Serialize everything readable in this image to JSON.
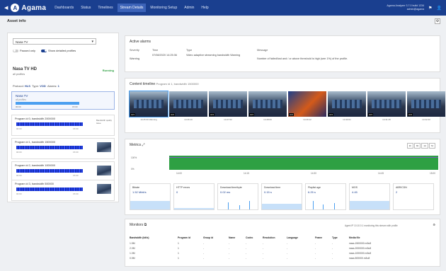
{
  "topbar": {
    "logo": "Agama",
    "nav": [
      "Dashboards",
      "Status",
      "Timelines",
      "Stream Details",
      "Monitoring Setup",
      "Admin",
      "Help"
    ],
    "active_nav": "Stream Details",
    "account_line1": "Agama Analyzer 3.7.0 build 1234",
    "account_line2": "admin@agama"
  },
  "page": {
    "title": "Asset info"
  },
  "left": {
    "select_value": "Nasa TV",
    "toggle_paused": "Paused only",
    "toggle_details": "Show detailed profiles",
    "asset_title": "Nasa TV HD",
    "asset_sub": "all profiles",
    "status": "Running",
    "protocol_label": "Protocol:",
    "protocol_value": "HLS",
    "type_label": "Type:",
    "type_value": "VOD",
    "alarms_label": "Alarms:",
    "alarms_value": "1",
    "summary": {
      "name": "Nasa TV",
      "sub": "all profiles",
      "left": "00:00",
      "right": "15:00"
    },
    "programs": [
      {
        "title": "Program id 0, bandwidth 2000000",
        "left": "00:00",
        "right": "15:00",
        "label": "Bandwidth quality issue"
      },
      {
        "title": "Program id 1, bandwidth 1500000",
        "left": "00:00",
        "right": "15:00"
      },
      {
        "title": "Program id 2, bandwidth 1000000",
        "left": "00:00",
        "right": "15:00"
      },
      {
        "title": "Program id 3, bandwidth 500000",
        "left": "00:00",
        "right": "15:00"
      }
    ]
  },
  "alarms": {
    "title": "Active alarms",
    "headers": [
      "Severity",
      "Time",
      "Type",
      "Message"
    ],
    "rows": [
      {
        "severity": "Warning",
        "time": "07/08/2020 14:25:36",
        "type": "Video adaptive streaming bandwidth Warning",
        "message": "Number of failed/lost and / or above threshold is high (see 1%) of the profile."
      }
    ]
  },
  "timeline": {
    "title": "Content timeline",
    "subtitle": "Program id 1, bandwidth 1500000",
    "captions": [
      "14:25:36 Warning",
      "14:26:10",
      "14:27:02",
      "14:28:00",
      "14:29:12",
      "14:30:01",
      "14:31:45",
      "14:32:20"
    ],
    "badge": "HLS"
  },
  "metrics": {
    "title": "Metrics",
    "range_buttons": [
      "1h",
      "6h",
      "1d",
      "7d"
    ],
    "ytick_top": "100%",
    "ytick_bottom": "0%",
    "xticks": [
      "14:00",
      "14:15",
      "14:30",
      "14:45",
      "15:00"
    ],
    "minis": [
      {
        "title": "Bitrate",
        "value": "1.52 Mbit/s"
      },
      {
        "title": "HTTP errors",
        "value": "0"
      },
      {
        "title": "Download time/byte",
        "value": "0.02 ms"
      },
      {
        "title": "Download time",
        "value": "0.15 s"
      },
      {
        "title": "Playlist age",
        "value": "6.25 s"
      },
      {
        "title": "MOS",
        "value": "4.45"
      },
      {
        "title": "ABR/CDN",
        "value": "2"
      }
    ]
  },
  "monitors": {
    "title": "Monitors",
    "note": "Agent IP 10.10.0.1 monitoring this stream with profile",
    "headers": [
      "Bandwidth (bit/s)",
      "Program id",
      "Group id",
      "Name",
      "Codec",
      "Resolution",
      "Language",
      "Frame",
      "Type",
      "Media file"
    ],
    "rows": [
      [
        "1.5M",
        "1",
        "-",
        "-",
        "-",
        "-",
        "-",
        "-",
        "-",
        "nasa-1500000.m3u8"
      ],
      [
        "2.0M",
        "1",
        "-",
        "-",
        "-",
        "-",
        "-",
        "-",
        "-",
        "nasa-2000000.m3u8"
      ],
      [
        "1.0M",
        "1",
        "-",
        "-",
        "-",
        "-",
        "-",
        "-",
        "-",
        "nasa-1000000.m3u8"
      ],
      [
        "0.5M",
        "1",
        "-",
        "-",
        "-",
        "-",
        "-",
        "-",
        "-",
        "nasa-500000.m3u8"
      ]
    ]
  },
  "colors": {
    "brand": "#1a3f8f",
    "ok": "#2ea043",
    "accent": "#4a9ff0"
  }
}
